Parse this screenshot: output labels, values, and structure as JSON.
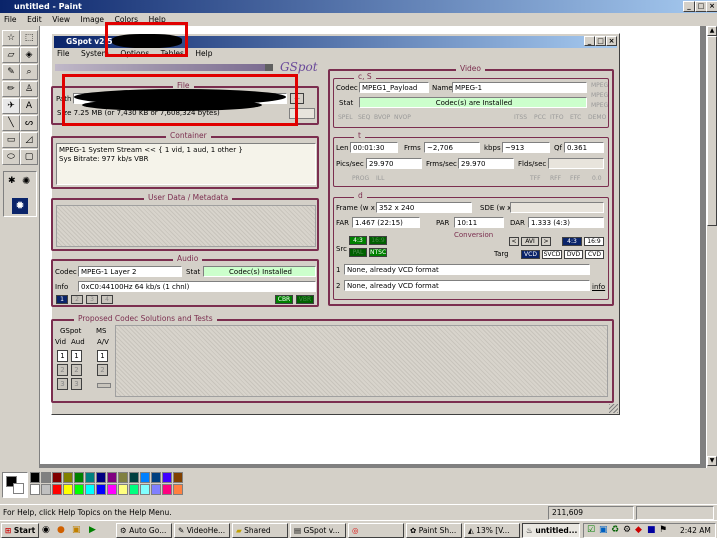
{
  "paint": {
    "title": "untitled - Paint",
    "menu": [
      "File",
      "Edit",
      "View",
      "Image",
      "Colors",
      "Help"
    ],
    "status_text": "For Help, click Help Topics on the Help Menu.",
    "coords": "211,609"
  },
  "gspot": {
    "title": "GSpot v2.52",
    "menu": [
      "File",
      "System",
      "Options",
      "Tables",
      "Help"
    ],
    "logo": "GSpot",
    "file": {
      "group": "File",
      "path_label": "Path",
      "size_text": "Size 7.25 MB (or 7,430 KB or 7,608,324 bytes)",
      "browse": "..."
    },
    "container": {
      "group": "Container",
      "lines": [
        "MPEG-1 System Stream << { 1 vid, 1 aud, 1 other }",
        "Sys Bitrate: 977 kb/s VBR"
      ]
    },
    "userdata": {
      "group": "User Data / Metadata"
    },
    "audio": {
      "group": "Audio",
      "codec_label": "Codec",
      "codec": "MPEG-1 Layer 2",
      "stat_label": "Stat",
      "stat": "Codec(s) Installed",
      "info_label": "Info",
      "info": "0xC0:44100Hz  64 kb/s (1 chnl)",
      "buttons": [
        "1",
        "2",
        "3",
        "4"
      ],
      "flags": [
        "CBR",
        "VBR"
      ]
    },
    "video": {
      "group": "Video",
      "cs_label": "c, S",
      "codec_label": "Codec",
      "codec": "MPEG1_Payload",
      "name_label": "Name",
      "name": "MPEG-1",
      "stat_label": "Stat",
      "stat": "Codec(s) are Installed",
      "side_tags": [
        "MPEG",
        "MPEG",
        "MPEG"
      ],
      "bottom_tags": [
        "SPEL",
        "SEQ",
        "BVOP",
        "NVOP"
      ],
      "bottom_tags_right": [
        "ITSS",
        "PCC",
        "ITFO",
        "ETC",
        "DEMO"
      ],
      "t_label": "t",
      "len_label": "Len",
      "len": "00:01:30",
      "frms_label": "Frms",
      "frms": "~2,706",
      "kbps_label": "kbps",
      "kbps": "~913",
      "qf_label": "Qf",
      "qf": "0.361",
      "pics_label": "Pics/sec",
      "pics": "29.970",
      "frms_sec_label": "Frms/sec",
      "frms_sec": "29.970",
      "flds_label": "Flds/sec",
      "t_tags": [
        "PROG",
        "ILL"
      ],
      "t_tags_right": [
        "TFF",
        "RFF",
        "FFF",
        "0.0"
      ],
      "d_label": "d",
      "frame_label": "Frame (w x",
      "frame": "352 x 240",
      "sde_label": "SDE (w x",
      "far_label": "FAR",
      "far": "1.467 (22:15)",
      "par_label": "PAR",
      "par": "10:11",
      "dar_label": "DAR",
      "dar": "1.333 (4:3)",
      "conversion_label": "Conversion",
      "src_label": "Src",
      "targ_label": "Targ",
      "src_buttons": [
        "4:3",
        "16:9"
      ],
      "src_buttons2": [
        "PAL",
        "NTSC"
      ],
      "conv_buttons": [
        "AVI",
        "4:3",
        "16:9"
      ],
      "targ_buttons": [
        "VCD",
        "SVCD",
        "DVD",
        "CVD"
      ],
      "results": [
        "None, already VCD format",
        "None, already VCD format"
      ],
      "result_nums": [
        "1",
        "2"
      ],
      "info_link": "info"
    },
    "proposed": {
      "group": "Proposed Codec Solutions and Tests",
      "gspot_label": "GSpot",
      "ms_label": "MS",
      "vid_label": "Vid",
      "aud_label": "Aud",
      "av_label": "A/V",
      "nums": [
        "1",
        "2",
        "3"
      ]
    }
  },
  "taskbar": {
    "start": "Start",
    "items": [
      "Auto Go...",
      "VideoHe...",
      "Shared",
      "GSpot v...",
      "",
      "Paint Sh...",
      "13% [V...",
      "untitled..."
    ],
    "clock": "2:42 AM"
  },
  "colors": {
    "accent": "#7b2e4f",
    "title_blue": "#0a246a",
    "highlight_red": "#e00000",
    "installed_green": "#ccffcc",
    "palette": [
      "#000000",
      "#808080",
      "#800000",
      "#808000",
      "#008000",
      "#008080",
      "#000080",
      "#800080",
      "#808040",
      "#004040",
      "#0080ff",
      "#004080",
      "#4000ff",
      "#804000",
      "#ffffff",
      "#c0c0c0",
      "#ff0000",
      "#ffff00",
      "#00ff00",
      "#00ffff",
      "#0000ff",
      "#ff00ff",
      "#ffff80",
      "#00ff80",
      "#80ffff",
      "#8080ff",
      "#ff0080",
      "#ff8040"
    ]
  }
}
